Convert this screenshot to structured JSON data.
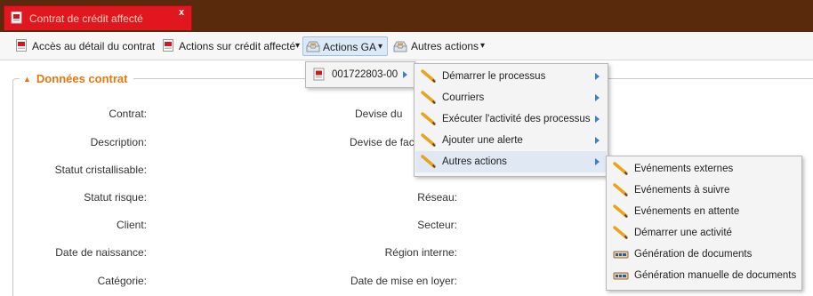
{
  "window": {
    "tab_title": "Contrat de crédit affecté",
    "close_label": "x"
  },
  "toolbar": {
    "items": [
      {
        "label": "Accès au détail du contrat",
        "icon": "pdf-icon",
        "dropdown": false
      },
      {
        "label": "Actions sur crédit affecté",
        "icon": "pdf-icon",
        "dropdown": true
      },
      {
        "label": "Actions GA",
        "icon": "inbox-icon",
        "dropdown": true
      },
      {
        "label": "Autres actions",
        "icon": "inbox-icon",
        "dropdown": true
      }
    ],
    "dropdown_glyph": "▾"
  },
  "section": {
    "title": "Données contrat",
    "collapse_glyph": "▲"
  },
  "fields_left": [
    "Contrat:",
    "Description:",
    "Statut cristallisable:",
    "Statut risque:",
    "Client:",
    "Date de naissance:",
    "Catégorie:"
  ],
  "fields_right": [
    "Devise du",
    "Devise de fac",
    "Réseau:",
    "Secteur:",
    "Région interne:",
    "Date de mise en loyer:"
  ],
  "menu_contract": {
    "item": "001722803-00"
  },
  "menu_actions": {
    "items": [
      "Démarrer le processus",
      "Courriers",
      "Exécuter l'activité des processus",
      "Ajouter une alerte",
      "Autres actions"
    ]
  },
  "menu_autres": {
    "items": [
      {
        "label": "Evénements externes",
        "icon": "pencil-icon"
      },
      {
        "label": "Evénements à suivre",
        "icon": "pencil-icon"
      },
      {
        "label": "Evénements en attente",
        "icon": "pencil-icon"
      },
      {
        "label": "Démarrer une activité",
        "icon": "pencil-icon"
      },
      {
        "label": "Génération de documents",
        "icon": "document-generate-icon"
      },
      {
        "label": "Génération manuelle de documents",
        "icon": "document-generate-icon"
      }
    ]
  },
  "colors": {
    "topbar": "#5a2a0c",
    "tab": "#e0171e",
    "section_title": "#e8760c",
    "submenu_arrow": "#3a7fd5"
  }
}
